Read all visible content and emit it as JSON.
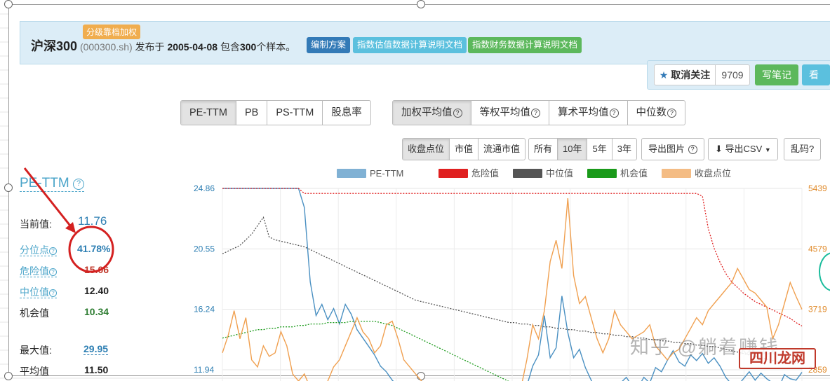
{
  "header": {
    "tag": "分级靠档加权",
    "name": "沪深300",
    "code": "(000300.sh)",
    "published_prefix": "发布于",
    "published_date": "2005-04-08",
    "contains_prefix": "包含",
    "sample_count": "300",
    "sample_suffix": "个样本。",
    "btn_scheme": "编制方案",
    "btn_valuation_doc": "指数估值数据计算说明文档",
    "btn_financial_doc": "指数财务数据计算说明文档"
  },
  "follow": {
    "unfollow_label": "取消关注",
    "count": "9709",
    "write_note": "写笔记",
    "view_note": "看笔"
  },
  "metric_tabs": [
    "PE-TTM",
    "PB",
    "PS-TTM",
    "股息率"
  ],
  "avg_tabs": [
    "加权平均值",
    "等权平均值",
    "算术平均值",
    "中位数"
  ],
  "price_tabs": [
    "收盘点位",
    "市值",
    "流通市值"
  ],
  "range_tabs": [
    "所有",
    "10年",
    "5年",
    "3年"
  ],
  "tools": {
    "export_image": "导出图片",
    "export_csv": "导出CSV",
    "garbled": "乱码?"
  },
  "stats": {
    "title": "PE-TTM",
    "current_label": "当前值:",
    "current_value": "11.76",
    "percentile_label": "分位点",
    "percentile_value": "41.78%",
    "danger_label": "危险值",
    "danger_value": "15.06",
    "median_label": "中位值",
    "median_value": "12.40",
    "chance_label": "机会值",
    "chance_value": "10.34",
    "max_label": "最大值:",
    "max_value": "29.95",
    "avg_label": "平均值",
    "avg_value": "11.50"
  },
  "colors": {
    "pe": "#4a90c2",
    "danger": "#e02020",
    "median": "#555555",
    "chance": "#1a9a1a",
    "close": "#f0a050",
    "annotation": "#d42020"
  },
  "watermark": {
    "text": "知乎 @躺着赚钱",
    "logo": "四川龙网"
  },
  "chart_data": {
    "type": "line",
    "legend": [
      "PE-TTM",
      "危险值",
      "中位值",
      "机会值",
      "收盘点位"
    ],
    "y_left_ticks": [
      "24.86",
      "20.55",
      "16.24",
      "11.94"
    ],
    "y_right_ticks": [
      "5439",
      "4579",
      "3719",
      "2859"
    ],
    "y_left_range": [
      11.94,
      24.86
    ],
    "y_right_range": [
      2859,
      5439
    ],
    "x": [
      0,
      1,
      2,
      3,
      4,
      5,
      6,
      7,
      8,
      9,
      10,
      11,
      12,
      13,
      14,
      15,
      16,
      17,
      18,
      19,
      20,
      21,
      22,
      23,
      24,
      25,
      26,
      27,
      28,
      29,
      30,
      31,
      32,
      33,
      34,
      35,
      36,
      37,
      38,
      39,
      40,
      41,
      42,
      43,
      44,
      45,
      46,
      47,
      48,
      49,
      50,
      51,
      52,
      53,
      54,
      55,
      56,
      57,
      58,
      59,
      60,
      61,
      62,
      63,
      64,
      65,
      66,
      67,
      68,
      69,
      70,
      71,
      72,
      73,
      74,
      75,
      76,
      77,
      78,
      79,
      80,
      81,
      82,
      83,
      84,
      85,
      86,
      87,
      88,
      89,
      90,
      91,
      92,
      93,
      94,
      95,
      96,
      97,
      98,
      99
    ],
    "series": [
      {
        "name": "PE-TTM",
        "axis": "left",
        "values": [
          24.86,
          24.86,
          24.86,
          24.86,
          24.86,
          24.86,
          24.86,
          24.86,
          24.86,
          24.86,
          24.86,
          24.86,
          24.86,
          24.86,
          23.5,
          18.2,
          15.8,
          16.6,
          15.5,
          16.3,
          15.2,
          16.6,
          15.9,
          14.8,
          14.2,
          13.6,
          13.0,
          12.2,
          11.8,
          11.2,
          10.8,
          10.6,
          10.4,
          10.2,
          10.3,
          10.1,
          9.9,
          9.8,
          9.8,
          9.7,
          9.6,
          9.5,
          9.4,
          9.3,
          9.3,
          9.2,
          9.1,
          9.1,
          9.0,
          9.0,
          9.1,
          9.8,
          10.8,
          12.2,
          13.0,
          15.8,
          12.8,
          13.5,
          17.2,
          14.6,
          12.8,
          13.4,
          12.1,
          11.2,
          10.4,
          10.0,
          9.8,
          10.4,
          11.0,
          11.4,
          10.8,
          10.7,
          11.4,
          11.0,
          12.1,
          11.8,
          12.6,
          13.3,
          12.5,
          12.2,
          13.0,
          12.6,
          13.1,
          12.4,
          12.8,
          12.2,
          11.4,
          10.9,
          10.8,
          11.3,
          11.8,
          11.2,
          11.7,
          11.3,
          11.0,
          10.6,
          11.6,
          11.3,
          11.2,
          11.76
        ]
      },
      {
        "name": "危险值",
        "axis": "left",
        "values": [
          24.86,
          24.86,
          24.86,
          24.86,
          24.86,
          24.86,
          24.86,
          24.86,
          24.86,
          24.86,
          24.86,
          24.86,
          24.86,
          24.86,
          24.5,
          24.5,
          24.5,
          24.5,
          24.5,
          24.5,
          24.5,
          24.5,
          24.5,
          24.5,
          24.5,
          24.5,
          24.5,
          24.5,
          24.5,
          24.5,
          24.5,
          24.5,
          24.5,
          24.5,
          24.5,
          24.5,
          24.5,
          24.5,
          24.5,
          24.5,
          24.5,
          24.5,
          24.5,
          24.5,
          24.5,
          24.5,
          24.5,
          24.5,
          24.5,
          24.5,
          24.5,
          24.5,
          24.5,
          24.5,
          24.5,
          24.5,
          24.5,
          24.5,
          24.5,
          24.5,
          24.5,
          24.5,
          24.5,
          24.5,
          24.5,
          24.5,
          24.5,
          24.5,
          24.5,
          24.5,
          24.5,
          24.5,
          24.5,
          24.5,
          24.5,
          24.5,
          24.5,
          24.5,
          24.5,
          24.5,
          24.5,
          24.5,
          24.3,
          22.0,
          20.6,
          19.6,
          18.8,
          18.2,
          17.8,
          17.4,
          17.1,
          16.8,
          16.6,
          16.4,
          16.2,
          16.0,
          15.8,
          15.6,
          15.3,
          15.06
        ]
      },
      {
        "name": "中位值",
        "axis": "left",
        "values": [
          20.2,
          20.4,
          20.6,
          20.8,
          21.2,
          21.6,
          22.2,
          22.8,
          21.4,
          21.2,
          21.1,
          21.0,
          20.9,
          20.8,
          20.7,
          20.5,
          20.3,
          20.1,
          19.9,
          19.7,
          19.5,
          19.3,
          19.1,
          18.9,
          18.7,
          18.5,
          18.3,
          18.1,
          17.9,
          17.7,
          17.5,
          17.3,
          17.1,
          16.9,
          16.8,
          16.7,
          16.6,
          16.5,
          16.4,
          16.3,
          16.2,
          16.1,
          16.0,
          15.9,
          15.8,
          15.7,
          15.6,
          15.5,
          15.4,
          15.3,
          15.3,
          15.2,
          15.2,
          15.1,
          15.1,
          15.0,
          15.0,
          14.9,
          14.9,
          14.8,
          14.8,
          14.7,
          14.7,
          14.6,
          14.6,
          14.5,
          14.5,
          14.4,
          14.4,
          14.3,
          14.3,
          14.2,
          14.2,
          14.1,
          14.1,
          14.0,
          14.0,
          13.9,
          13.9,
          13.8,
          13.8,
          13.7,
          13.7,
          13.6,
          13.6,
          13.5,
          13.4,
          13.3,
          13.2,
          13.1,
          13.0,
          12.9,
          12.8,
          12.7,
          12.6,
          12.5,
          12.5,
          12.4,
          12.4,
          12.4
        ]
      },
      {
        "name": "机会值",
        "axis": "left",
        "values": [
          14.2,
          14.3,
          14.4,
          14.5,
          14.6,
          14.7,
          14.8,
          14.8,
          14.9,
          14.9,
          15.0,
          15.0,
          15.0,
          15.1,
          15.1,
          15.2,
          15.2,
          15.2,
          15.3,
          15.3,
          15.3,
          15.3,
          15.4,
          15.4,
          15.4,
          15.4,
          15.4,
          15.3,
          15.2,
          15.1,
          14.9,
          14.7,
          14.5,
          14.3,
          14.1,
          13.9,
          13.7,
          13.5,
          13.3,
          13.1,
          12.9,
          12.7,
          12.5,
          12.3,
          12.1,
          11.9,
          11.7,
          11.5,
          11.3,
          11.1,
          10.9,
          10.8,
          10.7,
          10.6,
          10.5,
          10.5,
          10.4,
          10.4,
          10.4,
          10.4,
          10.4,
          10.4,
          10.4,
          10.4,
          10.4,
          10.4,
          10.4,
          10.4,
          10.4,
          10.4,
          10.4,
          10.4,
          10.4,
          10.4,
          10.4,
          10.4,
          10.4,
          10.4,
          10.4,
          10.4,
          10.4,
          10.4,
          10.4,
          10.4,
          10.4,
          10.4,
          10.4,
          10.4,
          10.4,
          10.4,
          10.4,
          10.4,
          10.4,
          10.4,
          10.4,
          10.4,
          10.4,
          10.4,
          10.4,
          10.34
        ]
      },
      {
        "name": "收盘点位",
        "axis": "right",
        "values": [
          3100,
          3350,
          3700,
          3300,
          3600,
          3000,
          2900,
          3200,
          3050,
          3100,
          3400,
          3200,
          2800,
          2700,
          2800,
          2600,
          2500,
          2600,
          2700,
          2900,
          3000,
          3200,
          3400,
          3600,
          3400,
          3300,
          3100,
          3200,
          3500,
          3550,
          3300,
          3000,
          2900,
          2800,
          2700,
          2600,
          2500,
          2450,
          2400,
          2350,
          2350,
          2300,
          2300,
          2250,
          2250,
          2200,
          2200,
          2200,
          2250,
          2300,
          2400,
          2600,
          3000,
          3500,
          3300,
          3700,
          4400,
          4700,
          4300,
          5300,
          4200,
          3800,
          3900,
          3600,
          3300,
          3100,
          3300,
          3700,
          3500,
          3400,
          3300,
          3350,
          3400,
          3500,
          3200,
          3100,
          3000,
          3100,
          3150,
          3300,
          3450,
          3600,
          3500,
          3700,
          3800,
          3900,
          4000,
          4100,
          4300,
          4150,
          4000,
          3950,
          3850,
          3750,
          3300,
          3500,
          3800,
          4100,
          3900,
          3719
        ]
      }
    ]
  }
}
